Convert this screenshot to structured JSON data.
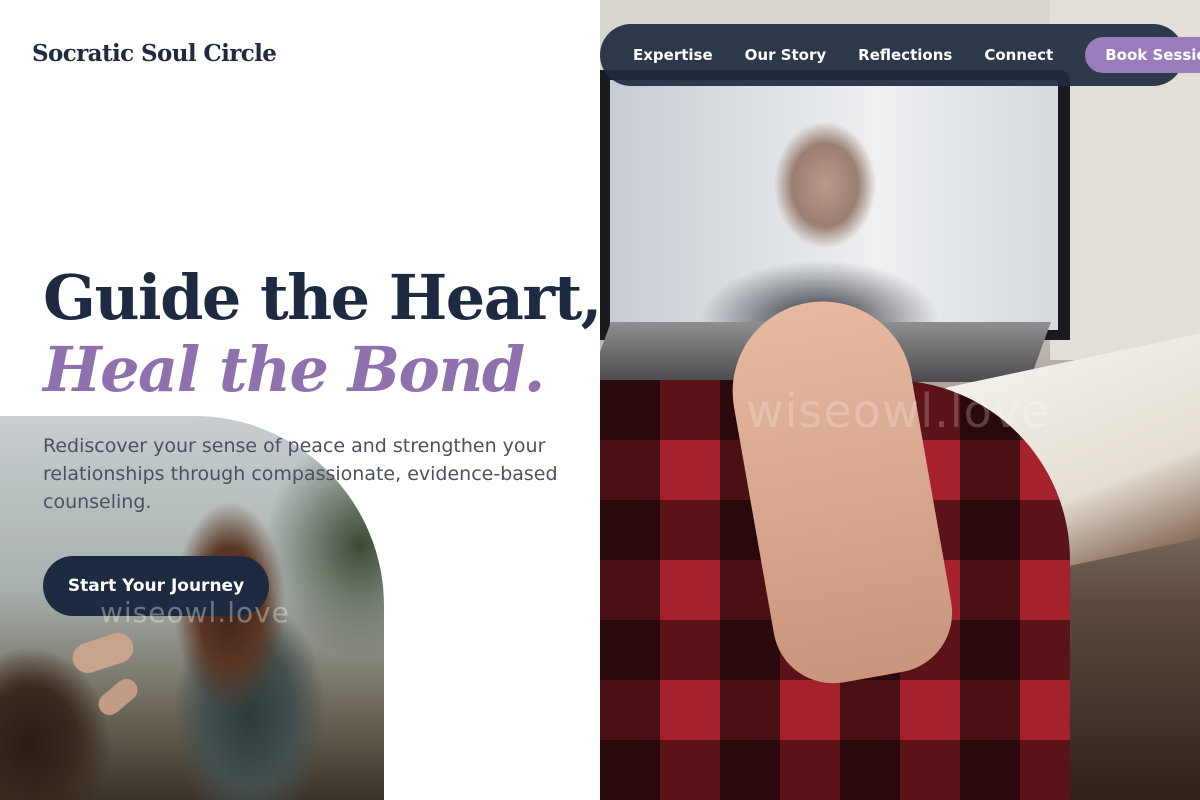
{
  "brand": {
    "name": "Socratic Soul Circle"
  },
  "nav": {
    "links": [
      "Expertise",
      "Our Story",
      "Reflections",
      "Connect"
    ],
    "cta_label": "Book Session"
  },
  "hero": {
    "title_line1": "Guide the Heart,",
    "title_line2": "Heal the Bond.",
    "description": "Rediscover your sense of peace and strengthen your relationships through compassionate, evidence-based counseling.",
    "cta_label": "Start Your Journey"
  },
  "watermark": {
    "text": "wiseowl.love"
  },
  "colors": {
    "navy": "#1e2a3f",
    "accent_purple": "#9b7cba",
    "title_italic": "#8f72ad"
  }
}
